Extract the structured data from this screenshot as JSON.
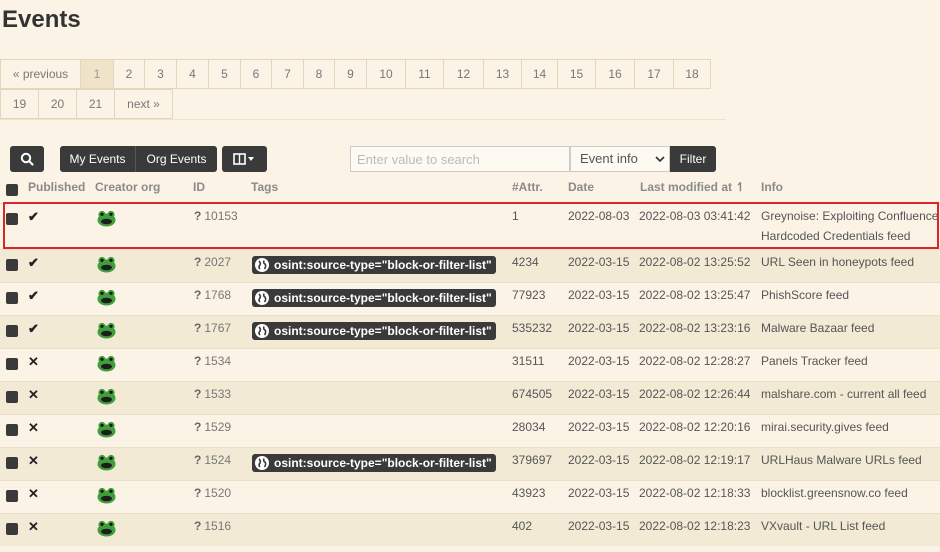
{
  "page": {
    "title": "Events"
  },
  "pagination": {
    "row1": [
      "« previous",
      "1",
      "2",
      "3",
      "4",
      "5",
      "6",
      "7",
      "8",
      "9",
      "10",
      "11",
      "12",
      "13",
      "14",
      "15",
      "16",
      "17",
      "18"
    ],
    "row2": [
      "19",
      "20",
      "21",
      "next »"
    ],
    "active": "1"
  },
  "toolbar": {
    "search_icon": "search-icon",
    "my_events": "My Events",
    "org_events": "Org Events",
    "columns_icon": "columns-icon",
    "search_placeholder": "Enter value to search",
    "scope_value": "Event info",
    "filter": "Filter"
  },
  "table": {
    "headers": {
      "published": "Published",
      "creator_org": "Creator org",
      "id": "ID",
      "tags": "Tags",
      "attr": "#Attr.",
      "date": "Date",
      "modified": "Last modified at ↿",
      "info": "Info"
    },
    "rows": [
      {
        "published": "✔",
        "id": "10153",
        "tag": "",
        "attr": "1",
        "date": "2022-08-03",
        "modified": "2022-08-03 03:41:42",
        "info": "Greynoise: Exploiting Confluence",
        "info2": "Hardcoded Credentials feed"
      },
      {
        "published": "✔",
        "id": "2027",
        "tag": "osint:source-type=\"block-or-filter-list\"",
        "attr": "4234",
        "date": "2022-03-15",
        "modified": "2022-08-02 13:25:52",
        "info": "URL Seen in honeypots feed"
      },
      {
        "published": "✔",
        "id": "1768",
        "tag": "osint:source-type=\"block-or-filter-list\"",
        "attr": "77923",
        "date": "2022-03-15",
        "modified": "2022-08-02 13:25:47",
        "info": "PhishScore feed"
      },
      {
        "published": "✔",
        "id": "1767",
        "tag": "osint:source-type=\"block-or-filter-list\"",
        "attr": "535232",
        "date": "2022-03-15",
        "modified": "2022-08-02 13:23:16",
        "info": "Malware Bazaar feed"
      },
      {
        "published": "✕",
        "id": "1534",
        "tag": "",
        "attr": "31511",
        "date": "2022-03-15",
        "modified": "2022-08-02 12:28:27",
        "info": "Panels Tracker feed"
      },
      {
        "published": "✕",
        "id": "1533",
        "tag": "",
        "attr": "674505",
        "date": "2022-03-15",
        "modified": "2022-08-02 12:26:44",
        "info": "malshare.com - current all feed"
      },
      {
        "published": "✕",
        "id": "1529",
        "tag": "",
        "attr": "28034",
        "date": "2022-03-15",
        "modified": "2022-08-02 12:20:16",
        "info": "mirai.security.gives feed"
      },
      {
        "published": "✕",
        "id": "1524",
        "tag": "osint:source-type=\"block-or-filter-list\"",
        "attr": "379697",
        "date": "2022-03-15",
        "modified": "2022-08-02 12:19:17",
        "info": "URLHaus Malware URLs feed"
      },
      {
        "published": "✕",
        "id": "1520",
        "tag": "",
        "attr": "43923",
        "date": "2022-03-15",
        "modified": "2022-08-02 12:18:33",
        "info": "blocklist.greensnow.co feed"
      },
      {
        "published": "✕",
        "id": "1516",
        "tag": "",
        "attr": "402",
        "date": "2022-03-15",
        "modified": "2022-08-02 12:18:23",
        "info": "VXvault - URL List feed"
      }
    ]
  },
  "colors": {
    "background": "#fbf4e6",
    "dark_button": "#3a3a3a",
    "highlight": "#d9262b",
    "frog": "#3f9f3b"
  }
}
